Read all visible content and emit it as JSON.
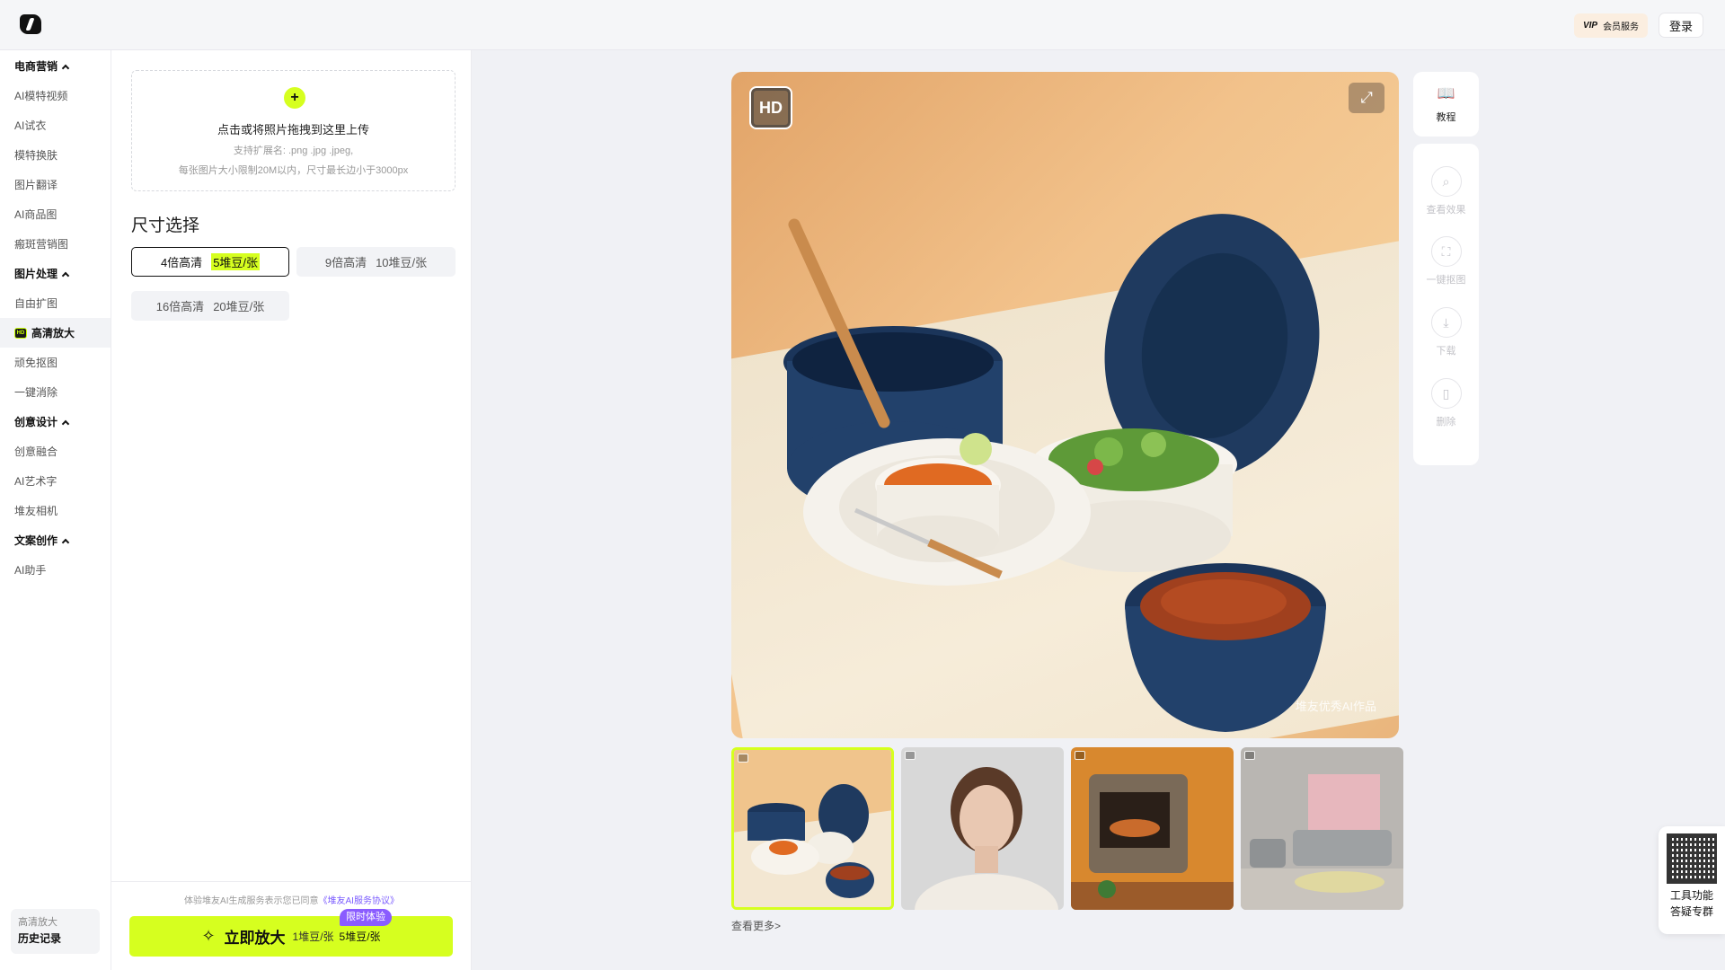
{
  "header": {
    "vip_label": "VIP",
    "vip_text": "会员服务",
    "login": "登录"
  },
  "nav": {
    "sections": [
      {
        "title": "电商营销",
        "items": [
          "AI模特视频",
          "AI试衣",
          "模特换肤",
          "图片翻译",
          "AI商品图",
          "瘢斑营销图"
        ]
      },
      {
        "title": "图片处理",
        "items": [
          "自由扩图",
          "高清放大",
          "顽免抠图",
          "一键消除"
        ]
      },
      {
        "title": "创意设计",
        "items": [
          "创意融合",
          "AI艺术字",
          "堆友相机"
        ]
      },
      {
        "title": "文案创作",
        "items": [
          "AI助手"
        ]
      }
    ],
    "history": {
      "line1": "高清放大",
      "line2": "历史记录"
    }
  },
  "panel": {
    "upload": {
      "main": "点击或将照片拖拽到这里上传",
      "formats": "支持扩展名: .png .jpg .jpeg,",
      "limits": "每张图片大小限制20M以内，尺寸最长边小于3000px"
    },
    "size_title": "尺寸选择",
    "options": [
      {
        "label": "4倍高清",
        "price": "5堆豆/张",
        "selected": true
      },
      {
        "label": "9倍高清",
        "price": "10堆豆/张",
        "selected": false
      },
      {
        "label": "16倍高清",
        "price": "20堆豆/张",
        "selected": false
      }
    ],
    "agreement": "体验堆友AI生成服务表示您已同意",
    "agreement_link": "《堆友AI服务协议》",
    "action": {
      "tag": "限时体验",
      "label": "立即放大",
      "old_price": "1堆豆/张",
      "new_price": "5堆豆/张"
    }
  },
  "preview": {
    "badge": "HD",
    "watermark": "堆友优秀AI作品"
  },
  "tools": {
    "tutorial": "教程",
    "items": [
      "查看效果",
      "一键抠图",
      "下载",
      "删除"
    ]
  },
  "gallery": {
    "more": "查看更多>"
  },
  "qr": {
    "line1": "工具功能",
    "line2": "答疑专群"
  },
  "colors": {
    "accent": "#d6ff1f",
    "tag": "#8a5cff"
  }
}
